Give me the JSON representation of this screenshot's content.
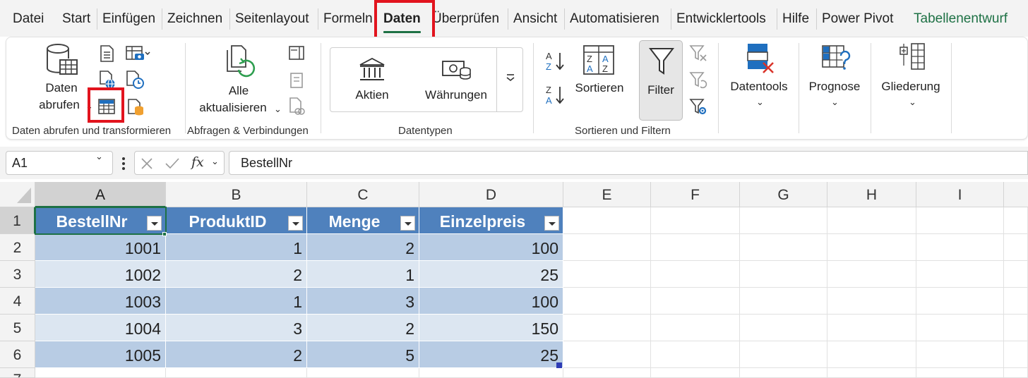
{
  "tabs": [
    "Datei",
    "Start",
    "Einfügen",
    "Zeichnen",
    "Seitenlayout",
    "Formeln",
    "Daten",
    "Überprüfen",
    "Ansicht",
    "Automatisieren",
    "Entwicklertools",
    "Hilfe",
    "Power Pivot",
    "Tabellenentwurf"
  ],
  "active_tab": "Daten",
  "ribbon": {
    "get_data": {
      "line1": "Daten",
      "line2": "abrufen",
      "group": "Daten abrufen und transformieren"
    },
    "queries": {
      "line1": "Alle",
      "line2": "aktualisieren",
      "group": "Abfragen & Verbindungen"
    },
    "datatypes": {
      "stocks": "Aktien",
      "currencies": "Währungen",
      "group": "Datentypen"
    },
    "sort_filter": {
      "sort": "Sortieren",
      "filter": "Filter",
      "group": "Sortieren und Filtern"
    },
    "datatools": {
      "label": "Datentools"
    },
    "forecast": {
      "label": "Prognose"
    },
    "outline": {
      "label": "Gliederung"
    }
  },
  "formula_bar": {
    "name_box": "A1",
    "fx": "fx",
    "content": "BestellNr"
  },
  "columns": [
    "A",
    "B",
    "C",
    "D",
    "E",
    "F",
    "G",
    "H",
    "I"
  ],
  "rows": [
    "1",
    "2",
    "3",
    "4",
    "5",
    "6",
    "7"
  ],
  "table": {
    "headers": [
      "BestellNr",
      "ProduktID",
      "Menge",
      "Einzelpreis"
    ],
    "rows": [
      [
        "1001",
        "1",
        "2",
        "100"
      ],
      [
        "1002",
        "2",
        "1",
        "25"
      ],
      [
        "1003",
        "1",
        "3",
        "100"
      ],
      [
        "1004",
        "3",
        "2",
        "150"
      ],
      [
        "1005",
        "2",
        "5",
        "25"
      ]
    ]
  },
  "colors": {
    "excel_green": "#1e7145",
    "highlight_red": "#e2141e",
    "table_header": "#4f81bd",
    "band_dark": "#b8cce4",
    "band_light": "#dce6f1"
  }
}
